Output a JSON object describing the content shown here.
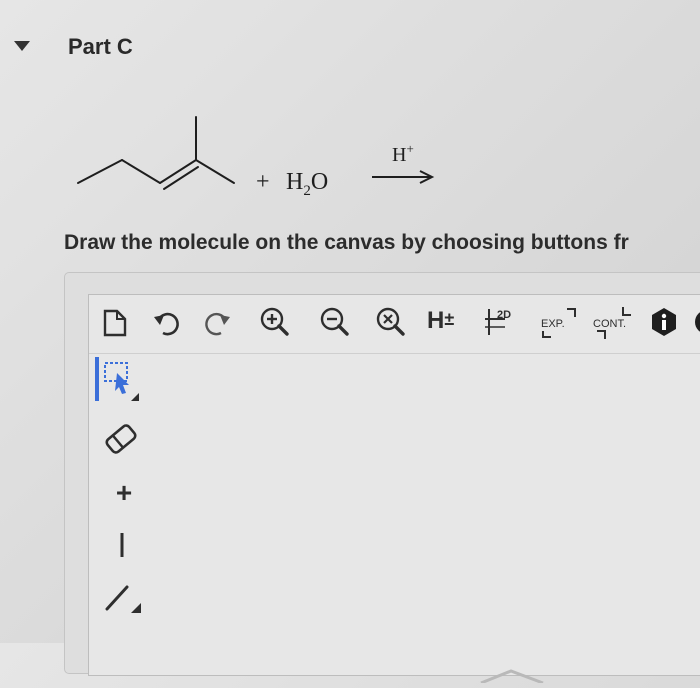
{
  "part": {
    "title": "Part C"
  },
  "reaction": {
    "plus": "+",
    "reagent_main": "H",
    "reagent_sub": "2",
    "reagent_tail": "O",
    "catalyst": "H",
    "catalyst_charge": "+"
  },
  "instruction": "Draw the molecule on the canvas by choosing buttons fr",
  "toolbar": {
    "h_toggle": "H",
    "h_toggle_mark": "±",
    "clean_2d": "2D",
    "expand": "EXP.",
    "contract": "CONT."
  },
  "side_toolbar": {
    "add_label": "+",
    "minus_label": "−"
  },
  "colors": {
    "accent": "#3b6fd9",
    "icon_dark": "#2e2e2e",
    "info_badge": "#1f1f1f"
  }
}
